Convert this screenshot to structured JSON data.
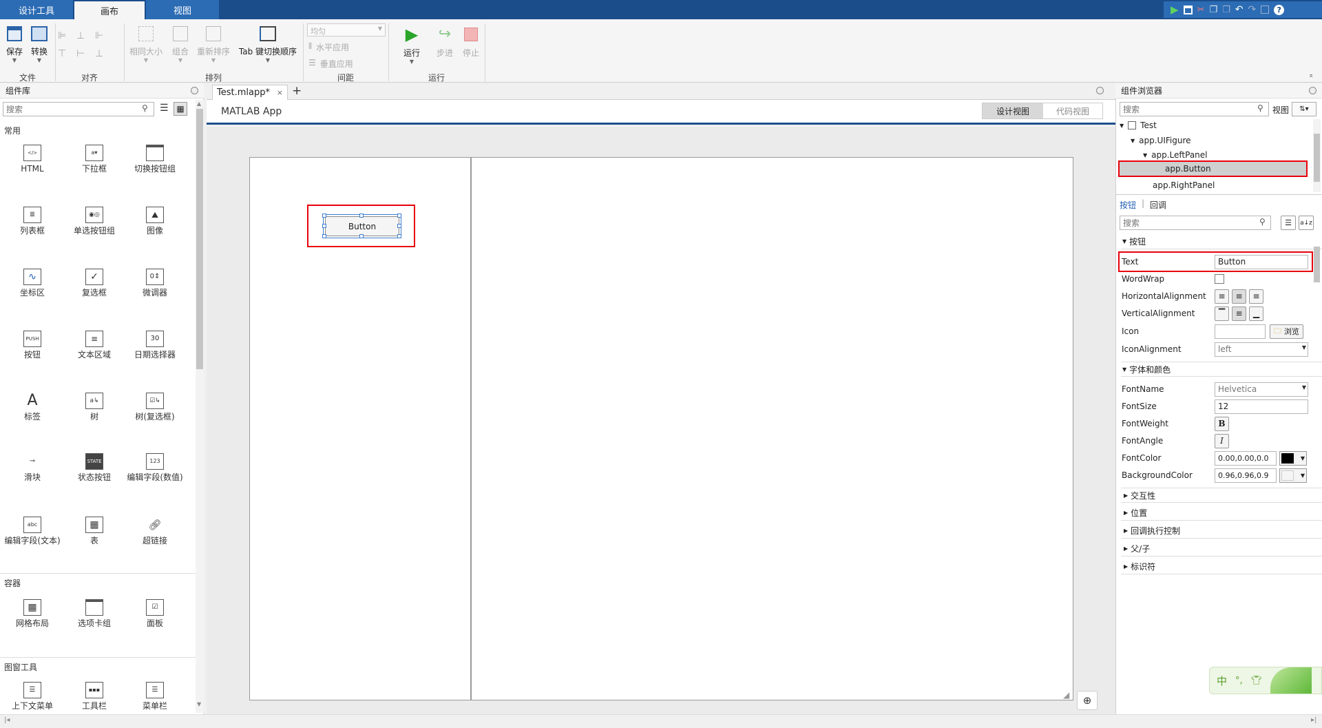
{
  "tabs": [
    {
      "label": "设计工具"
    },
    {
      "label": "画布"
    },
    {
      "label": "视图"
    }
  ],
  "ribbon": {
    "file": {
      "save": "保存",
      "convert": "转换",
      "group": "文件"
    },
    "align": {
      "group": "对齐"
    },
    "arrange": {
      "same_size": "相同大小",
      "group_btn": "组合",
      "reorder": "重新排序",
      "tab_order": "Tab 键切换顺序",
      "group": "排列"
    },
    "spacing": {
      "dropdown": "均匀",
      "horizontal": "水平应用",
      "vertical": "垂直应用",
      "group": "间距"
    },
    "run": {
      "run": "运行",
      "step": "步进",
      "stop": "停止",
      "group": "运行"
    }
  },
  "library": {
    "title": "组件库",
    "search_placeholder": "搜索",
    "sections": {
      "common": {
        "title": "常用",
        "items": [
          "HTML",
          "下拉框",
          "切换按钮组",
          "列表框",
          "单选按钮组",
          "图像",
          "坐标区",
          "复选框",
          "微调器",
          "按钮",
          "文本区域",
          "日期选择器",
          "标签",
          "树",
          "树(复选框)",
          "滑块",
          "状态按钮",
          "编辑字段(数值)",
          "编辑字段(文本)",
          "表",
          "超链接"
        ]
      },
      "containers": {
        "title": "容器",
        "items": [
          "网格布局",
          "选项卡组",
          "面板"
        ]
      },
      "figure_tools": {
        "title": "图窗工具",
        "items": [
          "上下文菜单",
          "工具栏",
          "菜单栏"
        ]
      }
    }
  },
  "editor": {
    "tab_label": "Test.mlapp*",
    "app_title": "MATLAB App",
    "design_view": "设计视图",
    "code_view": "代码视图",
    "canvas_button": "Button"
  },
  "browser": {
    "title": "组件浏览器",
    "search_placeholder": "搜索",
    "view_label": "视图",
    "tree": [
      "Test",
      "app.UIFigure",
      "app.LeftPanel",
      "app.Button",
      "app.RightPanel"
    ],
    "tabs": [
      "按钮",
      "回调"
    ],
    "prop_search_placeholder": "搜索",
    "button_section": "按钮",
    "props": {
      "text": {
        "label": "Text",
        "value": "Button"
      },
      "wordwrap": {
        "label": "WordWrap"
      },
      "halign": {
        "label": "HorizontalAlignment"
      },
      "valign": {
        "label": "VerticalAlignment"
      },
      "icon": {
        "label": "Icon",
        "browse": "浏览"
      },
      "iconalign": {
        "label": "IconAlignment",
        "value": "left"
      }
    },
    "font_section": "字体和颜色",
    "font": {
      "name": {
        "label": "FontName",
        "value": "Helvetica"
      },
      "size": {
        "label": "FontSize",
        "value": "12"
      },
      "weight": {
        "label": "FontWeight",
        "value": "B"
      },
      "angle": {
        "label": "FontAngle",
        "value": "I"
      },
      "color": {
        "label": "FontColor",
        "value": "0.00,0.00,0.0"
      },
      "bg": {
        "label": "BackgroundColor",
        "value": "0.96,0.96,0.9"
      }
    },
    "collapsed": [
      "交互性",
      "位置",
      "回调执行控制",
      "父/子",
      "标识符"
    ]
  },
  "ime": {
    "text": "中"
  },
  "colors": {
    "titlebar": "#1b4d8b",
    "tab_active": "#f5f5f5",
    "highlight": "#e8000b",
    "canvas_bg": "#ebebeb"
  }
}
